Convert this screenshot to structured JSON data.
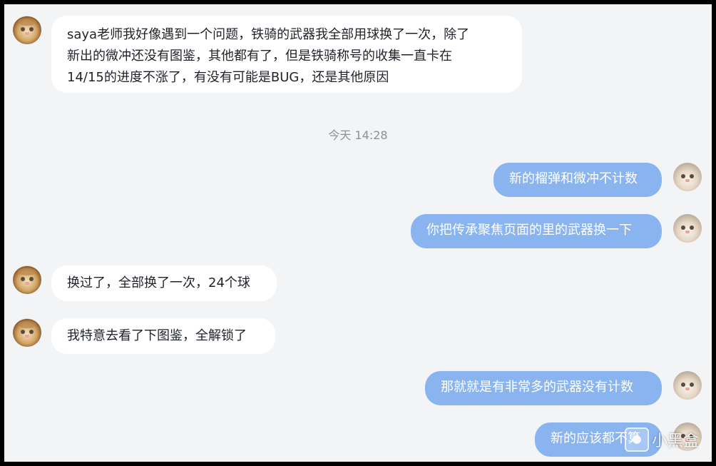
{
  "messages": [
    {
      "direction": "incoming",
      "lines": [
        "saya老师我好像遇到一个问题，铁骑的武器我全部用球换了一次，除了",
        "新出的微冲还没有图鉴，其他都有了，但是铁骑称号的收集一直卡在",
        "14/15的进度不涨了，有没有可能是BUG，还是其他原因"
      ]
    },
    {
      "direction": "outgoing",
      "text": "新的榴弹和微冲不计数"
    },
    {
      "direction": "outgoing",
      "text": "你把传承聚焦页面的里的武器换一下"
    },
    {
      "direction": "incoming",
      "text": "换过了，全部换了一次，24个球"
    },
    {
      "direction": "incoming",
      "text": "我特意去看了下图鉴，全解锁了"
    },
    {
      "direction": "outgoing",
      "text": "那就就是有非常多的武器没有计数"
    },
    {
      "direction": "outgoing",
      "text": "新的应该都不算"
    }
  ],
  "timestamp": "今天 14:28",
  "watermark": {
    "text": "小黑盒",
    "icon": "heybox-logo-icon"
  },
  "avatars": {
    "sender": "dog-avatar",
    "self": "cat-avatar"
  }
}
